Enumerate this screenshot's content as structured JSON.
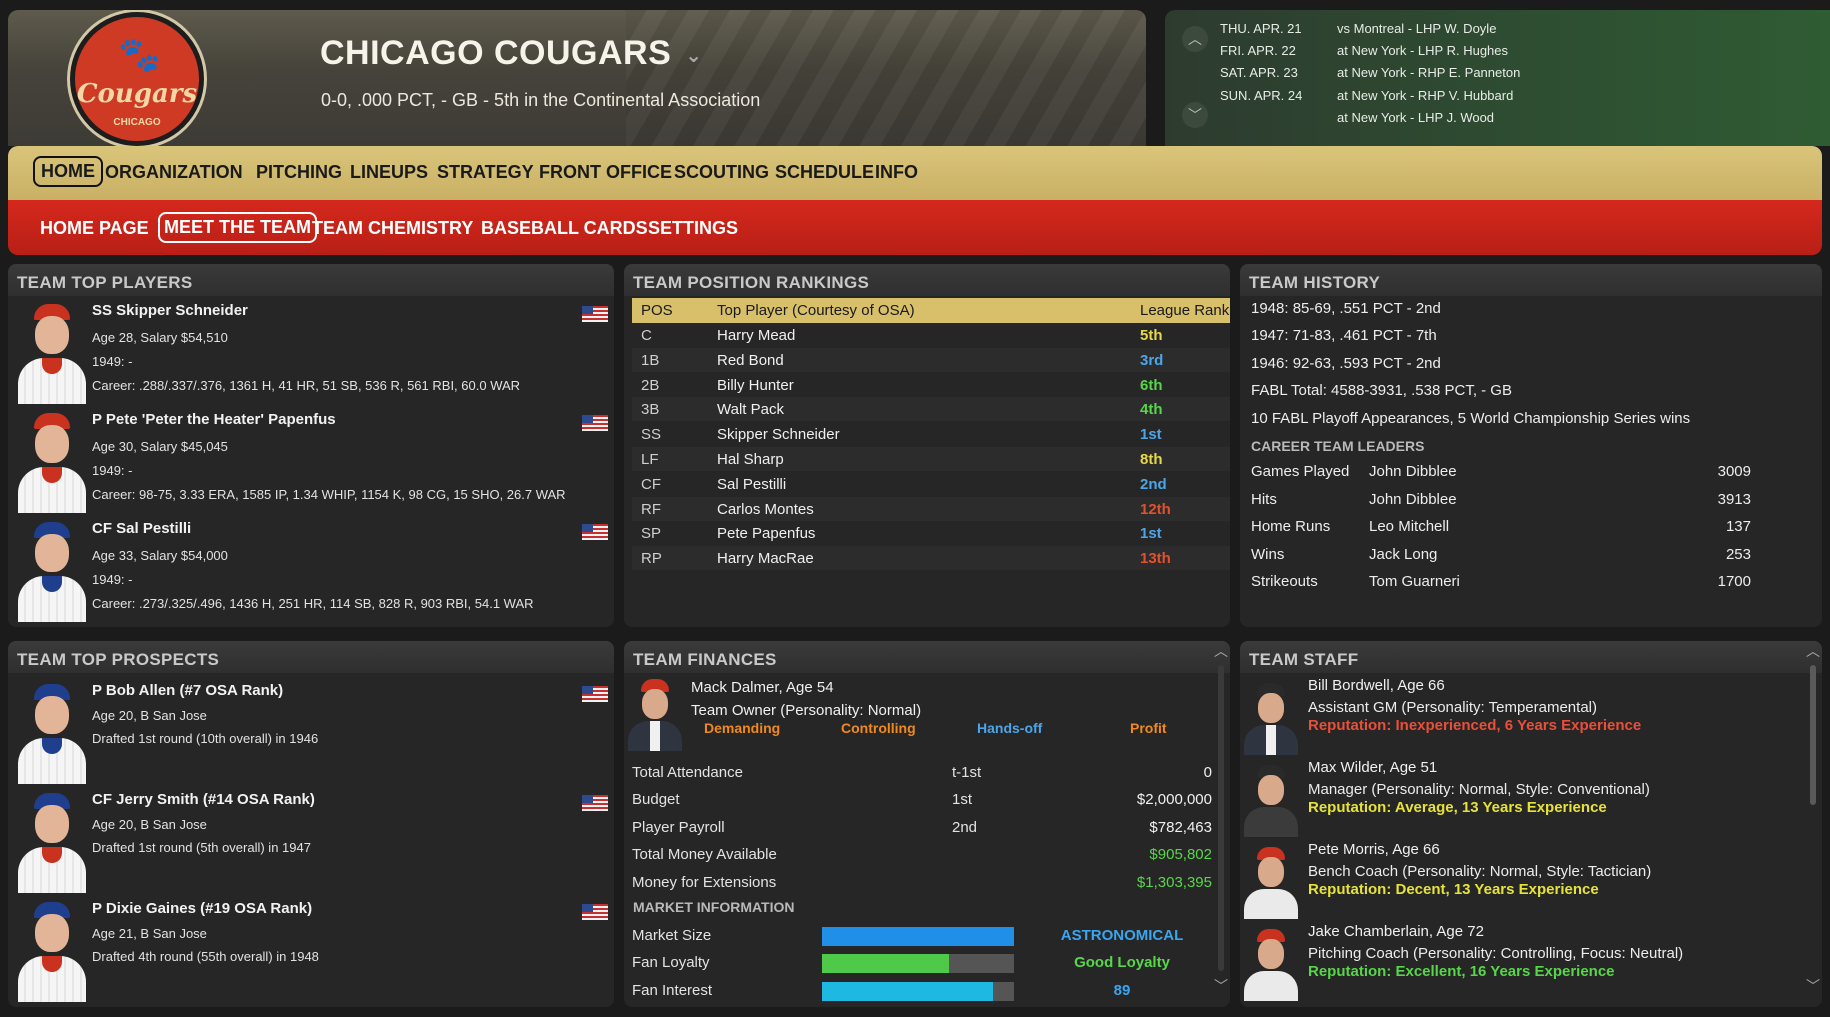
{
  "header": {
    "logo_text": "Cougars",
    "logo_subtext": "CHICAGO",
    "team_name": "CHICAGO COUGARS",
    "record": "0-0, .000 PCT, - GB - 5th in the Continental Association"
  },
  "schedule": [
    {
      "date": "THU. APR. 21",
      "game": "vs Montreal - LHP W. Doyle"
    },
    {
      "date": "FRI. APR. 22",
      "game": "at New York - LHP R. Hughes"
    },
    {
      "date": "SAT. APR. 23",
      "game": "at New York - RHP E. Panneton"
    },
    {
      "date": "SUN. APR. 24",
      "game": "at New York - RHP V. Hubbard"
    },
    {
      "date": "",
      "game": "at New York - LHP J. Wood"
    }
  ],
  "nav_main": [
    "HOME",
    "ORGANIZATION",
    "PITCHING",
    "LINEUPS",
    "STRATEGY",
    "FRONT OFFICE",
    "SCOUTING",
    "SCHEDULE",
    "INFO"
  ],
  "nav_sub": [
    "HOME PAGE",
    "MEET THE TEAM",
    "TEAM CHEMISTRY",
    "BASEBALL CARDS",
    "SETTINGS"
  ],
  "top_players": {
    "title": "TEAM TOP PLAYERS",
    "players": [
      {
        "name": "SS Skipper Schneider",
        "line1": "Age 28, Salary $54,510",
        "line2": "1949: -",
        "line3": "Career: .288/.337/.376, 1361 H, 41 HR, 51 SB, 536 R, 561 RBI, 60.0 WAR"
      },
      {
        "name": "P Pete 'Peter the Heater' Papenfus",
        "line1": "Age 30, Salary $45,045",
        "line2": "1949: -",
        "line3": "Career: 98-75, 3.33 ERA, 1585 IP, 1.34 WHIP, 1154 K, 98 CG, 15 SHO, 26.7 WAR"
      },
      {
        "name": "CF Sal Pestilli",
        "line1": "Age 33, Salary $54,000",
        "line2": "1949: -",
        "line3": "Career: .273/.325/.496, 1436 H, 251 HR, 114 SB, 828 R, 903 RBI, 54.1 WAR"
      }
    ]
  },
  "top_prospects": {
    "title": "TEAM TOP PROSPECTS",
    "players": [
      {
        "name": "P Bob Allen (#7 OSA Rank)",
        "line1": "Age 20, B San Jose",
        "line2": "Drafted 1st round (10th overall) in 1946"
      },
      {
        "name": "CF Jerry Smith (#14 OSA Rank)",
        "line1": "Age 20, B San Jose",
        "line2": "Drafted 1st round (5th overall) in 1947"
      },
      {
        "name": "P Dixie Gaines (#19 OSA Rank)",
        "line1": "Age 21, B San Jose",
        "line2": "Drafted 4th round (55th overall) in 1948"
      }
    ]
  },
  "rankings": {
    "title": "TEAM POSITION RANKINGS",
    "col_pos": "POS",
    "col_player": "Top Player (Courtesy of OSA)",
    "col_rank": "League Rank",
    "rows": [
      {
        "pos": "C",
        "player": "Harry Mead",
        "rank": "5th",
        "color": "#e6d84a"
      },
      {
        "pos": "1B",
        "player": "Red Bond",
        "rank": "3rd",
        "color": "#4aa6e8"
      },
      {
        "pos": "2B",
        "player": "Billy Hunter",
        "rank": "6th",
        "color": "#58d64a"
      },
      {
        "pos": "3B",
        "player": "Walt Pack",
        "rank": "4th",
        "color": "#58d64a"
      },
      {
        "pos": "SS",
        "player": "Skipper Schneider",
        "rank": "1st",
        "color": "#4aa6e8"
      },
      {
        "pos": "LF",
        "player": "Hal Sharp",
        "rank": "8th",
        "color": "#e6d84a"
      },
      {
        "pos": "CF",
        "player": "Sal Pestilli",
        "rank": "2nd",
        "color": "#4aa6e8"
      },
      {
        "pos": "RF",
        "player": "Carlos Montes",
        "rank": "12th",
        "color": "#e0522e"
      },
      {
        "pos": "SP",
        "player": "Pete Papenfus",
        "rank": "1st",
        "color": "#4aa6e8"
      },
      {
        "pos": "RP",
        "player": "Harry MacRae",
        "rank": "13th",
        "color": "#e0522e"
      }
    ]
  },
  "history": {
    "title": "TEAM HISTORY",
    "lines": [
      "1948: 85-69, .551 PCT - 2nd",
      "1947: 71-83, .461 PCT - 7th",
      "1946: 92-63, .593 PCT - 2nd",
      "FABL Total: 4588-3931, .538 PCT, - GB",
      "10 FABL Playoff Appearances, 5 World Championship Series wins"
    ],
    "leaders_title": "CAREER TEAM LEADERS",
    "leaders": [
      {
        "cat": "Games Played",
        "name": "John Dibblee",
        "val": "3009"
      },
      {
        "cat": "Hits",
        "name": "John Dibblee",
        "val": "3913"
      },
      {
        "cat": "Home Runs",
        "name": "Leo Mitchell",
        "val": "137"
      },
      {
        "cat": "Wins",
        "name": "Jack Long",
        "val": "253"
      },
      {
        "cat": "Strikeouts",
        "name": "Tom Guarneri",
        "val": "1700"
      }
    ]
  },
  "finances": {
    "title": "TEAM FINANCES",
    "owner_name": "Mack Dalmer, Age 54",
    "owner_role": "Team Owner (Personality: Normal)",
    "traits": [
      {
        "label": "Demanding",
        "color": "#f08a1c"
      },
      {
        "label": "Controlling",
        "color": "#f08a1c"
      },
      {
        "label": "Hands-off",
        "color": "#4aa6e8"
      },
      {
        "label": "Profit",
        "color": "#f08a1c"
      }
    ],
    "rows": [
      {
        "label": "Total Attendance",
        "rank": "t-1st",
        "value": "0",
        "color": "#f0f0f0"
      },
      {
        "label": "Budget",
        "rank": "1st",
        "value": "$2,000,000",
        "color": "#f0f0f0"
      },
      {
        "label": "Player Payroll",
        "rank": "2nd",
        "value": "$782,463",
        "color": "#f0f0f0"
      },
      {
        "label": "Total Money Available",
        "rank": "",
        "value": "$905,802",
        "color": "#58d64a"
      },
      {
        "label": "Money for Extensions",
        "rank": "",
        "value": "$1,303,395",
        "color": "#58d64a"
      }
    ],
    "market_title": "MARKET INFORMATION",
    "market": [
      {
        "label": "Market Size",
        "value": "ASTRONOMICAL",
        "fill": 1.0,
        "bar_color": "#1f8fe8",
        "text_color": "#3aa6f0"
      },
      {
        "label": "Fan Loyalty",
        "value": "Good Loyalty",
        "fill": 0.66,
        "bar_color": "#4ec94a",
        "text_color": "#58d64a"
      },
      {
        "label": "Fan Interest",
        "value": "89",
        "fill": 0.89,
        "bar_color": "#1fb8e0",
        "text_color": "#3aa6f0"
      }
    ]
  },
  "staff": {
    "title": "TEAM STAFF",
    "members": [
      {
        "name": "Bill Bordwell, Age 66",
        "role": "Assistant GM (Personality: Temperamental)",
        "rep": "Reputation: Inexperienced, 6 Years Experience",
        "rep_color": "#e8503a"
      },
      {
        "name": "Max Wilder, Age 51",
        "role": "Manager (Personality: Normal, Style: Conventional)",
        "rep": "Reputation: Average, 13 Years Experience",
        "rep_color": "#e6e23a"
      },
      {
        "name": "Pete Morris, Age 66",
        "role": "Bench Coach (Personality: Normal, Style: Tactician)",
        "rep": "Reputation: Decent, 13 Years Experience",
        "rep_color": "#e6e23a"
      },
      {
        "name": "Jake Chamberlain, Age 72",
        "role": "Pitching Coach (Personality: Controlling, Focus: Neutral)",
        "rep": "Reputation: Excellent, 16 Years Experience",
        "rep_color": "#58d64a"
      }
    ]
  }
}
